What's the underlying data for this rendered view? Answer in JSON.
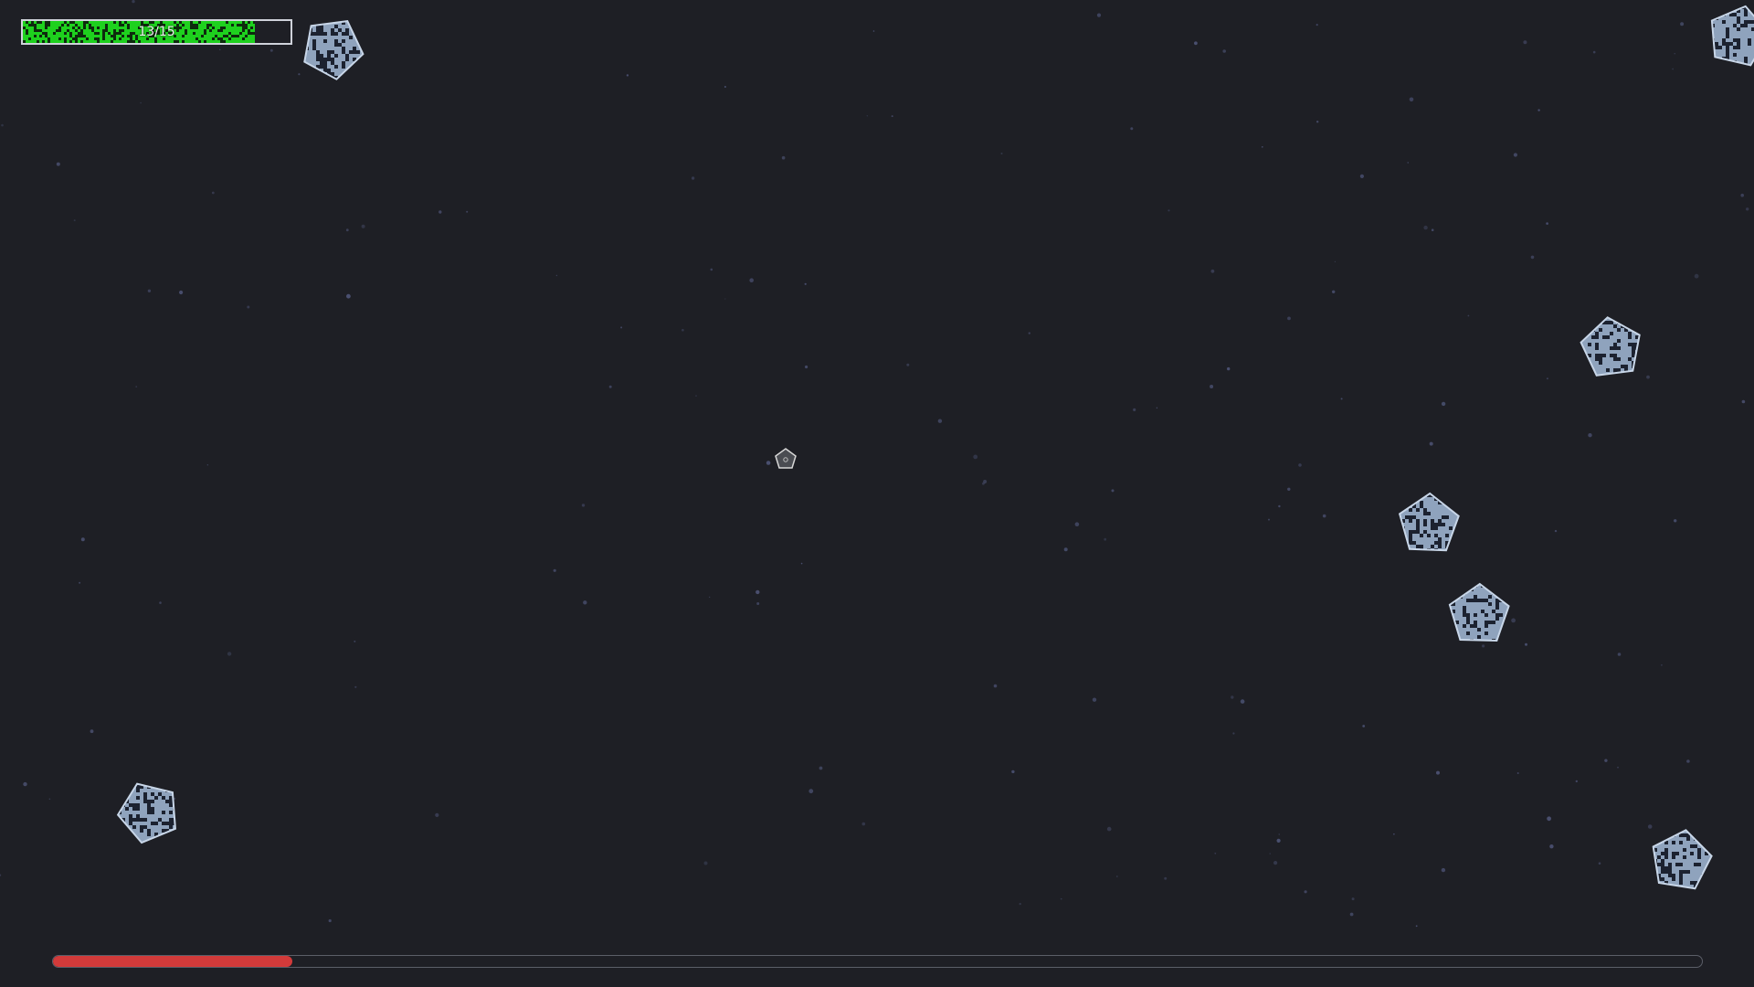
{
  "health": {
    "current": 13,
    "max": 15,
    "text": "13/15",
    "color": "#1ed11e"
  },
  "progress": {
    "fraction": 0.145,
    "color": "#d23a3a"
  },
  "colors": {
    "background": "#1e1f25",
    "asteroid": "#8fa3bd",
    "asteroid_edge": "#c8d6e8",
    "star": "#4a5070"
  },
  "asteroids": [
    {
      "name": "asteroid-1"
    },
    {
      "name": "asteroid-2"
    },
    {
      "name": "asteroid-3"
    },
    {
      "name": "asteroid-4"
    },
    {
      "name": "asteroid-5"
    },
    {
      "name": "asteroid-6"
    },
    {
      "name": "asteroid-7"
    }
  ],
  "player": {
    "icon": "ship-icon"
  }
}
